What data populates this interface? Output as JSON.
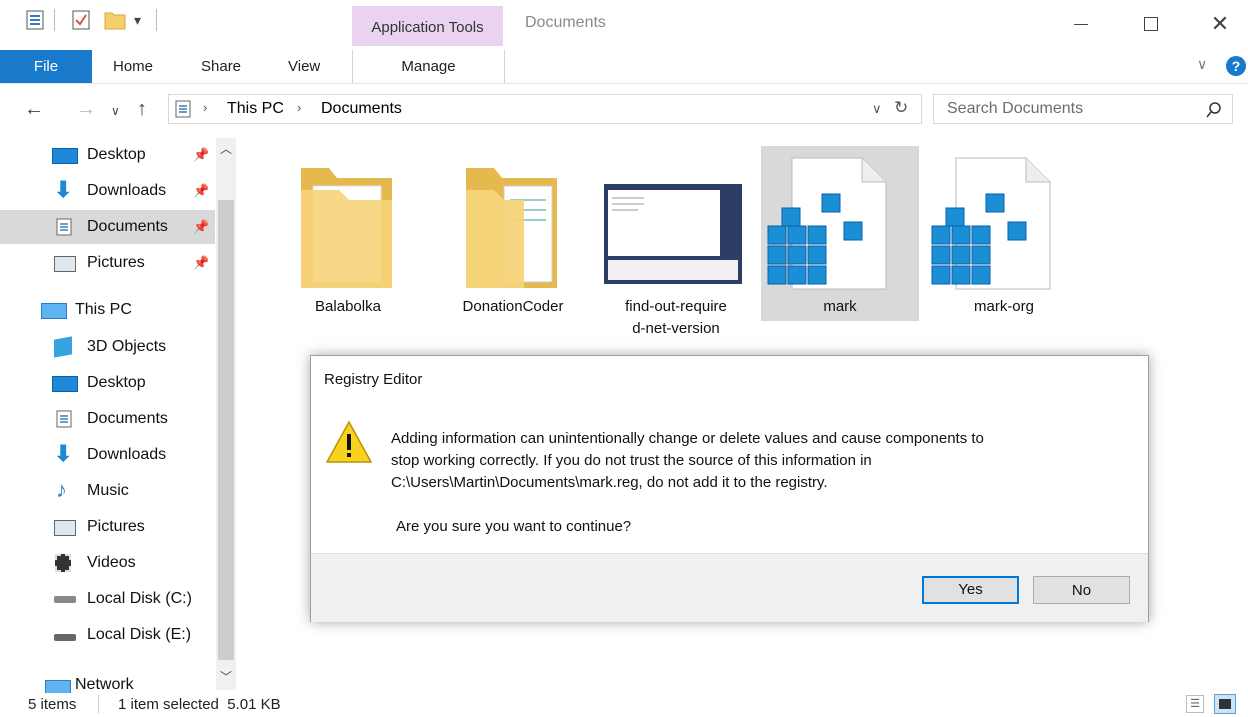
{
  "window": {
    "title": "Documents",
    "context_tab": "Application Tools",
    "minimize_icon": "minimize-icon",
    "maximize_icon": "maximize-icon",
    "close_icon": "close-icon"
  },
  "ribbon": {
    "file": "File",
    "tabs": [
      "Home",
      "Share",
      "View"
    ],
    "manage": "Manage"
  },
  "address": {
    "crumbs": [
      "This PC",
      "Documents"
    ],
    "search_placeholder": "Search Documents"
  },
  "sidebar": {
    "quick_access": [
      {
        "label": "Desktop",
        "icon": "desktop-icon",
        "pinned": true
      },
      {
        "label": "Downloads",
        "icon": "downloads-icon",
        "pinned": true
      },
      {
        "label": "Documents",
        "icon": "documents-icon",
        "pinned": true,
        "selected": true
      },
      {
        "label": "Pictures",
        "icon": "pictures-icon",
        "pinned": true
      }
    ],
    "this_pc": "This PC",
    "pc_items": [
      {
        "label": "3D Objects",
        "icon": "3d-objects-icon"
      },
      {
        "label": "Desktop",
        "icon": "desktop-icon"
      },
      {
        "label": "Documents",
        "icon": "documents-icon"
      },
      {
        "label": "Downloads",
        "icon": "downloads-icon"
      },
      {
        "label": "Music",
        "icon": "music-icon"
      },
      {
        "label": "Pictures",
        "icon": "pictures-icon"
      },
      {
        "label": "Videos",
        "icon": "videos-icon"
      },
      {
        "label": "Local Disk (C:)",
        "icon": "local-disk-c-icon"
      },
      {
        "label": "Local Disk (E:)",
        "icon": "local-disk-e-icon"
      }
    ],
    "network": "Network"
  },
  "files": [
    {
      "label": "Balabolka",
      "icon": "folder-icon"
    },
    {
      "label": "DonationCoder",
      "icon": "folder-icon"
    },
    {
      "label": "find-out-required-net-version",
      "label_lines": [
        "find-out-require",
        "d-net-version"
      ],
      "icon": "screenshot-thumbnail-icon"
    },
    {
      "label": "mark",
      "icon": "registry-file-icon",
      "selected": true
    },
    {
      "label": "mark-org",
      "icon": "registry-file-icon"
    }
  ],
  "dialog": {
    "title": "Registry Editor",
    "message_lines": [
      "Adding information can unintentionally change or delete values and cause components to",
      "stop working correctly. If you do not trust the source of this information in",
      "C:\\Users\\Martin\\Documents\\mark.reg, do not add it to the registry."
    ],
    "question": "Are you sure you want to continue?",
    "yes": "Yes",
    "no": "No",
    "icon": "warning-icon"
  },
  "status": {
    "items": "5 items",
    "selected": "1 item selected  5.01 KB"
  },
  "colors": {
    "accent": "#1979ca",
    "context_tab": "#e9d3f1",
    "selection": "#d9d9d9"
  }
}
